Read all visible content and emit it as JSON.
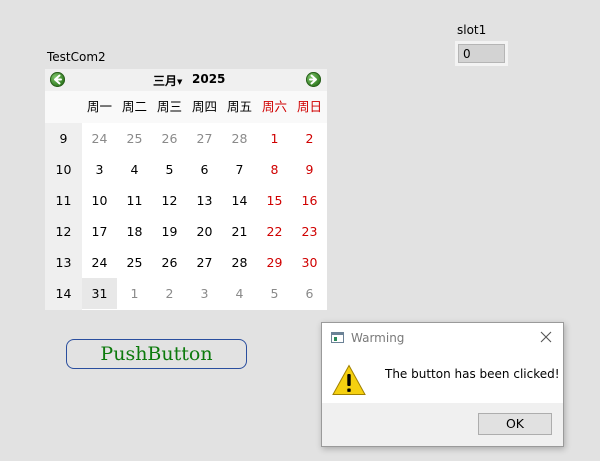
{
  "slot": {
    "label": "slot1",
    "value": "0"
  },
  "calendar": {
    "title": "TestCom2",
    "month": "三月",
    "year": "2025",
    "weekdays": [
      "周一",
      "周二",
      "周三",
      "周四",
      "周五",
      "周六",
      "周日"
    ],
    "weeks": [
      {
        "week": "9",
        "days": [
          "24",
          "25",
          "26",
          "27",
          "28",
          "1",
          "2"
        ]
      },
      {
        "week": "10",
        "days": [
          "3",
          "4",
          "5",
          "6",
          "7",
          "8",
          "9"
        ]
      },
      {
        "week": "11",
        "days": [
          "10",
          "11",
          "12",
          "13",
          "14",
          "15",
          "16"
        ]
      },
      {
        "week": "12",
        "days": [
          "17",
          "18",
          "19",
          "20",
          "21",
          "22",
          "23"
        ]
      },
      {
        "week": "13",
        "days": [
          "24",
          "25",
          "26",
          "27",
          "28",
          "29",
          "30"
        ]
      },
      {
        "week": "14",
        "days": [
          "31",
          "1",
          "2",
          "3",
          "4",
          "5",
          "6"
        ]
      }
    ],
    "selected_day": "31",
    "icons": {
      "prev": "arrow-left-icon",
      "next": "arrow-right-icon"
    },
    "weekend_color": "#d00000"
  },
  "push_button": {
    "label": "PushButton",
    "color": "#0c7a0c"
  },
  "dialog": {
    "title": "Warming",
    "message": "The button has been clicked!",
    "ok_label": "OK",
    "icons": {
      "app": "window-icon",
      "close": "close-icon",
      "warning": "warning-icon"
    }
  }
}
